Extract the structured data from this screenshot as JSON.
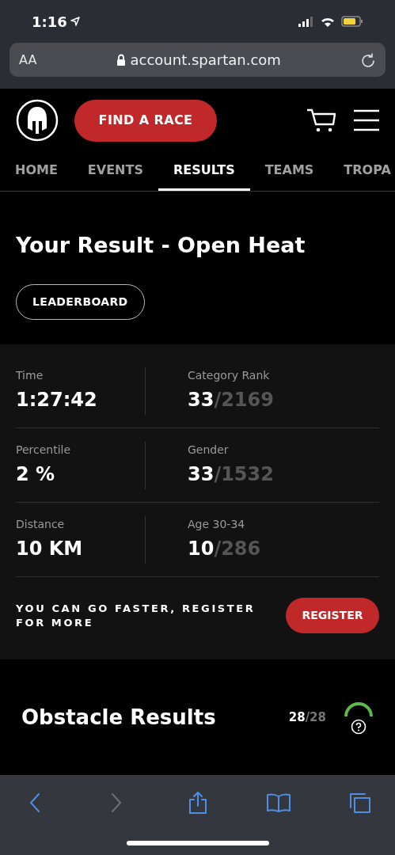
{
  "status_bar": {
    "time": "1:16"
  },
  "address_bar": {
    "text_size": "AA",
    "url": "account.spartan.com"
  },
  "header": {
    "cta": "FIND A RACE"
  },
  "tabs": [
    {
      "label": "HOME",
      "selected": false
    },
    {
      "label": "EVENTS",
      "selected": false
    },
    {
      "label": "RESULTS",
      "selected": true
    },
    {
      "label": "TEAMS",
      "selected": false
    },
    {
      "label": "TROPA",
      "selected": false
    }
  ],
  "result": {
    "title": "Your Result - Open Heat",
    "leaderboard_button": "LEADERBOARD"
  },
  "stats": [
    {
      "left": {
        "label": "Time",
        "value": "1:27:42"
      },
      "right": {
        "label": "Category Rank",
        "rank": "33",
        "total": "/2169"
      }
    },
    {
      "left": {
        "label": "Percentile",
        "value": "2 %"
      },
      "right": {
        "label": "Gender",
        "rank": "33",
        "total": "/1532"
      }
    },
    {
      "left": {
        "label": "Distance",
        "value": "10 KM"
      },
      "right": {
        "label": "Age 30-34",
        "rank": "10",
        "total": "/286"
      }
    }
  ],
  "promo": {
    "text": "YOU CAN GO FASTER, REGISTER FOR MORE",
    "button": "REGISTER"
  },
  "obstacles": {
    "title": "Obstacle Results",
    "done": "28",
    "total": "/28"
  },
  "toolbar": [
    {
      "kind": "back",
      "disabled": false
    },
    {
      "kind": "forward",
      "disabled": true
    },
    {
      "kind": "share",
      "disabled": false
    },
    {
      "kind": "bookmarks",
      "disabled": false
    },
    {
      "kind": "tabs",
      "disabled": false
    }
  ]
}
